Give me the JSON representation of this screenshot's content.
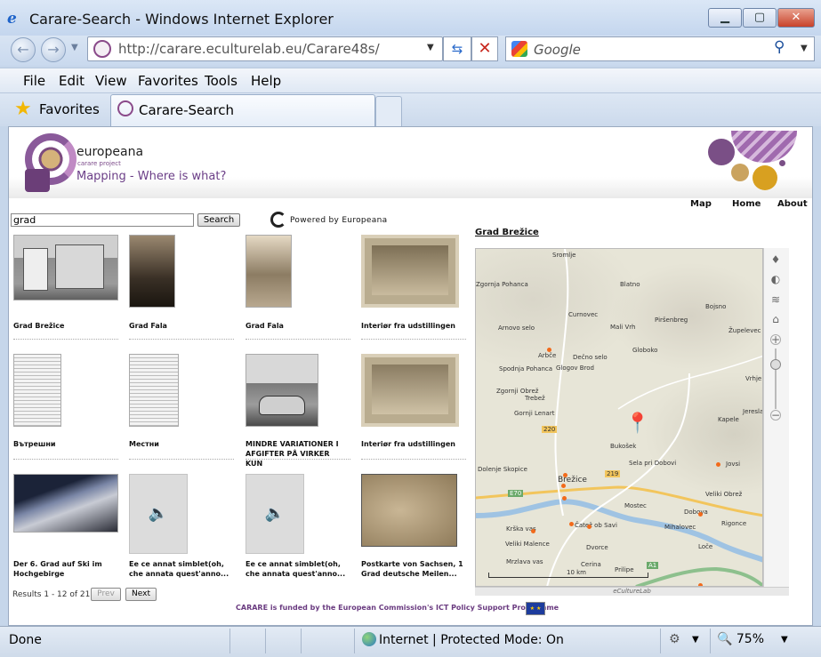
{
  "window": {
    "title": "Carare-Search - Windows Internet Explorer"
  },
  "address": {
    "url": "http://carare.eculturelab.eu/Carare48s/"
  },
  "search_provider": {
    "placeholder": "Google"
  },
  "menu": [
    "File",
    "Edit",
    "View",
    "Favorites",
    "Tools",
    "Help"
  ],
  "favorites": {
    "label": "Favorites"
  },
  "tab": {
    "label": "Carare-Search"
  },
  "header": {
    "brand": "europeana",
    "brand_sub": "carare project",
    "tagline": "Mapping - Where is what?"
  },
  "nav": [
    "Map",
    "Home",
    "About"
  ],
  "search": {
    "value": "grad",
    "button": "Search",
    "powered": "Powered by Europeana"
  },
  "results": [
    {
      "caption": "Grad Brežice",
      "kind": "photo"
    },
    {
      "caption": "Grad Fala",
      "kind": "photo"
    },
    {
      "caption": "Grad Fala",
      "kind": "photo"
    },
    {
      "caption": "Interiør fra udstillingen",
      "kind": "photo"
    },
    {
      "caption": "Вътрешни",
      "kind": "document"
    },
    {
      "caption": "Местни",
      "kind": "document"
    },
    {
      "caption": "MINDRE VARIATIONER I AFGIFTER PÅ VIRKER KUN",
      "kind": "photo"
    },
    {
      "caption": "Interiør fra udstillingen",
      "kind": "photo"
    },
    {
      "caption": "Der 6. Grad auf Ski im Hochgebirge",
      "kind": "photo"
    },
    {
      "caption": "Ee ce annat simblet(oh, che annata quest'anno...",
      "kind": "audio"
    },
    {
      "caption": "Ee ce annat simblet(oh, che annata quest'anno...",
      "kind": "audio"
    },
    {
      "caption": "Postkarte von Sachsen, 1 Grad deutsche Meilen...",
      "kind": "map"
    }
  ],
  "pagination": {
    "summary": "Results 1 - 12 of 21",
    "prev": "Prev",
    "next": "Next"
  },
  "map": {
    "title": "Grad Brežice",
    "footer": "eCultureLab",
    "scale": "10 km",
    "towns": [
      "Sromlje",
      "Zgornja Pohanca",
      "Blatno",
      "Bojsno",
      "Curnovec",
      "Piršenbreg",
      "Župelevec",
      "Arnovo selo",
      "Mali Vrh",
      "Arbče",
      "Dečno selo",
      "Globoko",
      "Glogov Brod",
      "Spodnja Pohanca",
      "Zgornji Obrež",
      "Trebež",
      "Vrhje",
      "Gornji Lenart",
      "Kapele",
      "Jereslavec",
      "Bukošek",
      "Sela pri Dobovi",
      "Jovsi",
      "Brežice",
      "Dolenje Skopice",
      "Veliki Obrež",
      "Mostec",
      "Dobova",
      "Krška vas",
      "Mihalovec",
      "Rigonce",
      "Veliki Malence",
      "Čatež ob Savi",
      "Dvorce",
      "Loče",
      "Mrzlava vas",
      "Cerina",
      "Prilipe"
    ],
    "road_labels": [
      "220",
      "219",
      "E70",
      "A1"
    ]
  },
  "footer": {
    "funding": "CARARE is funded by the European Commission's ICT Policy Support Programme"
  },
  "status": {
    "left": "Done",
    "zone": "Internet | Protected Mode: On",
    "zoom": "75%"
  }
}
